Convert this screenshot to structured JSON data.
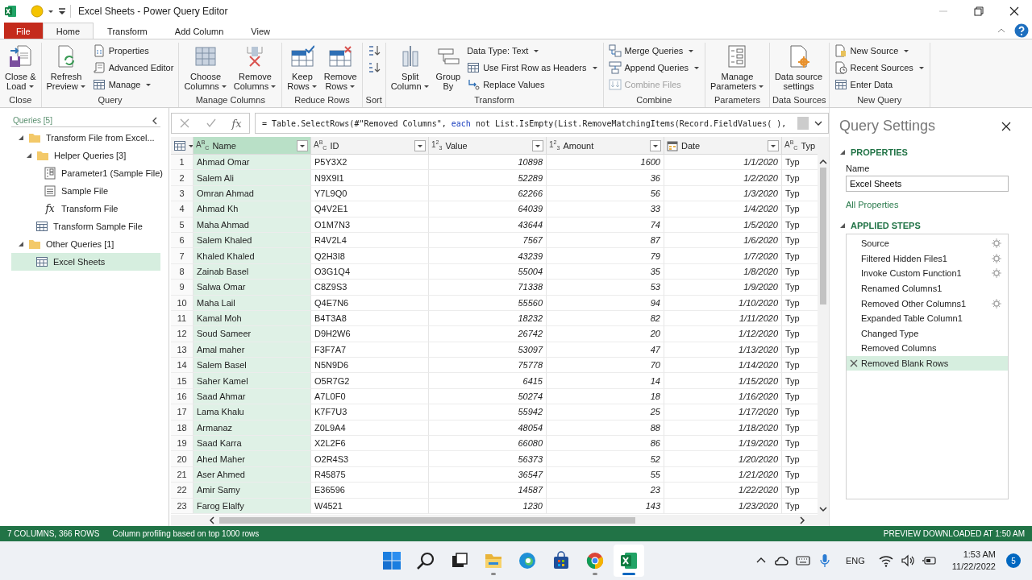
{
  "window": {
    "title": "Excel Sheets - Power Query Editor"
  },
  "ribbon_tabs": [
    {
      "label": "File",
      "kind": "file",
      "selected": false
    },
    {
      "label": "Home",
      "kind": "tab",
      "selected": true
    },
    {
      "label": "Transform",
      "kind": "tab",
      "selected": false
    },
    {
      "label": "Add Column",
      "kind": "tab",
      "selected": false
    },
    {
      "label": "View",
      "kind": "tab",
      "selected": false
    }
  ],
  "ribbon_groups": [
    {
      "label": "Close",
      "items": [
        {
          "kind": "big",
          "lines": [
            "Close &",
            "Load"
          ],
          "dropdown": true
        }
      ]
    },
    {
      "label": "Query",
      "items": [
        {
          "kind": "big",
          "lines": [
            "Refresh",
            "Preview"
          ],
          "dropdown": true
        },
        {
          "kind": "small",
          "label": "Properties",
          "dropdown": false
        },
        {
          "kind": "small",
          "label": "Advanced Editor",
          "dropdown": false
        },
        {
          "kind": "small",
          "label": "Manage",
          "dropdown": true
        }
      ]
    },
    {
      "label": "Manage Columns",
      "items": [
        {
          "kind": "big",
          "lines": [
            "Choose",
            "Columns"
          ],
          "dropdown": true
        },
        {
          "kind": "big",
          "lines": [
            "Remove",
            "Columns"
          ],
          "dropdown": true
        }
      ]
    },
    {
      "label": "Reduce Rows",
      "items": [
        {
          "kind": "big",
          "lines": [
            "Keep",
            "Rows"
          ],
          "dropdown": true
        },
        {
          "kind": "big",
          "lines": [
            "Remove",
            "Rows"
          ],
          "dropdown": true
        }
      ]
    },
    {
      "label": "Sort",
      "items": [
        {
          "kind": "small",
          "dropdown": false
        },
        {
          "kind": "small",
          "dropdown": false
        }
      ]
    },
    {
      "label": "Transform",
      "items": [
        {
          "kind": "big",
          "lines": [
            "Split",
            "Column"
          ],
          "dropdown": true
        },
        {
          "kind": "big",
          "lines": [
            "Group",
            "By"
          ],
          "dropdown": false
        },
        {
          "kind": "small",
          "label": "Data Type: Text",
          "dropdown": true
        },
        {
          "kind": "small",
          "label": "Use First Row as Headers",
          "dropdown": true
        },
        {
          "kind": "small",
          "label": "Replace Values",
          "dropdown": false
        }
      ]
    },
    {
      "label": "Combine",
      "items": [
        {
          "kind": "small",
          "label": "Merge Queries",
          "dropdown": true
        },
        {
          "kind": "small",
          "label": "Append Queries",
          "dropdown": true
        },
        {
          "kind": "small",
          "label": "Combine Files",
          "dropdown": false,
          "disabled": true
        }
      ]
    },
    {
      "label": "Parameters",
      "items": [
        {
          "kind": "big",
          "lines": [
            "Manage",
            "Parameters"
          ],
          "dropdown": true
        }
      ]
    },
    {
      "label": "Data Sources",
      "items": [
        {
          "kind": "big",
          "lines": [
            "Data source",
            "settings"
          ],
          "dropdown": false
        }
      ]
    },
    {
      "label": "New Query",
      "items": [
        {
          "kind": "small",
          "label": "New Source",
          "dropdown": true
        },
        {
          "kind": "small",
          "label": "Recent Sources",
          "dropdown": true
        },
        {
          "kind": "small",
          "label": "Enter Data",
          "dropdown": false
        }
      ]
    }
  ],
  "queries": {
    "title": "Queries [5]",
    "items": [
      {
        "label": "Transform File from Excel...",
        "kind": "folder",
        "expanded": true,
        "selected": false,
        "children": [
          {
            "label": "Helper Queries [3]",
            "kind": "folder",
            "expanded": true,
            "selected": false,
            "children": [
              {
                "label": "Parameter1 (Sample File)",
                "kind": "parameter",
                "selected": false
              },
              {
                "label": "Sample File",
                "kind": "file",
                "selected": false
              },
              {
                "label": "Transform File",
                "kind": "function",
                "glyph": "fx",
                "selected": false
              }
            ]
          },
          {
            "label": "Transform Sample File",
            "kind": "table",
            "selected": false
          }
        ]
      },
      {
        "label": "Other Queries [1]",
        "kind": "folder",
        "expanded": true,
        "selected": false,
        "children": [
          {
            "label": "Excel Sheets",
            "kind": "table",
            "selected": true
          }
        ]
      }
    ]
  },
  "formula_bar": {
    "fx": "fx",
    "formula": [
      {
        "text": "= Table.SelectRows(#\"Removed Columns\", ",
        "keyword": false
      },
      {
        "text": "each",
        "keyword": true
      },
      {
        "text": " not List.IsEmpty(List.RemoveMatchingItems(Record.FieldValues(_),",
        "keyword": false
      }
    ]
  },
  "table": {
    "columns": [
      {
        "name": "Name",
        "badge": "A$^{B}$$_{C}$",
        "kind": "text",
        "filter": true,
        "selected": true
      },
      {
        "name": "ID",
        "badge": "A$^{B}$$_{C}$",
        "kind": "text",
        "filter": true,
        "selected": false
      },
      {
        "name": "Value",
        "badge": "1$^{2}$$_{3}$",
        "kind": "number",
        "filter": true,
        "selected": false
      },
      {
        "name": "Amount",
        "badge": "1$^{2}$$_{3}$",
        "kind": "number",
        "filter": true,
        "selected": false
      },
      {
        "name": "Date",
        "kind": "date",
        "filter": true,
        "selected": false
      },
      {
        "name": "Typ",
        "badge": "A$^{B}$$_{C}$",
        "kind": "text",
        "filter": false,
        "selected": false
      }
    ],
    "rows": [
      {
        "number": "1",
        "cells": [
          "Ahmad Omar",
          "P5Y3X2",
          "10898",
          "1600",
          "1/1/2020",
          "Typ"
        ]
      },
      {
        "number": "2",
        "cells": [
          "Salem Ali",
          "N9X9I1",
          "52289",
          "36",
          "1/2/2020",
          "Typ"
        ]
      },
      {
        "number": "3",
        "cells": [
          "Omran Ahmad",
          "Y7L9Q0",
          "62266",
          "56",
          "1/3/2020",
          "Typ"
        ]
      },
      {
        "number": "4",
        "cells": [
          "Ahmad Kh",
          "Q4V2E1",
          "64039",
          "33",
          "1/4/2020",
          "Typ"
        ]
      },
      {
        "number": "5",
        "cells": [
          "Maha Ahmad",
          "O1M7N3",
          "43644",
          "74",
          "1/5/2020",
          "Typ"
        ]
      },
      {
        "number": "6",
        "cells": [
          "Salem Khaled",
          "R4V2L4",
          "7567",
          "87",
          "1/6/2020",
          "Typ"
        ]
      },
      {
        "number": "7",
        "cells": [
          "Khaled Khaled",
          "Q2H3I8",
          "43239",
          "79",
          "1/7/2020",
          "Typ"
        ]
      },
      {
        "number": "8",
        "cells": [
          "Zainab Basel",
          "O3G1Q4",
          "55004",
          "35",
          "1/8/2020",
          "Typ"
        ]
      },
      {
        "number": "9",
        "cells": [
          "Salwa Omar",
          "C8Z9S3",
          "71338",
          "53",
          "1/9/2020",
          "Typ"
        ]
      },
      {
        "number": "10",
        "cells": [
          "Maha Lail",
          "Q4E7N6",
          "55560",
          "94",
          "1/10/2020",
          "Typ"
        ]
      },
      {
        "number": "11",
        "cells": [
          "Kamal Moh",
          "B4T3A8",
          "18232",
          "82",
          "1/11/2020",
          "Typ"
        ]
      },
      {
        "number": "12",
        "cells": [
          "Soud Sameer",
          "D9H2W6",
          "26742",
          "20",
          "1/12/2020",
          "Typ"
        ]
      },
      {
        "number": "13",
        "cells": [
          "Amal maher",
          "F3F7A7",
          "53097",
          "47",
          "1/13/2020",
          "Typ"
        ]
      },
      {
        "number": "14",
        "cells": [
          "Salem Basel",
          "N5N9D6",
          "75778",
          "70",
          "1/14/2020",
          "Typ"
        ]
      },
      {
        "number": "15",
        "cells": [
          "Saher Kamel",
          "O5R7G2",
          "6415",
          "14",
          "1/15/2020",
          "Typ"
        ]
      },
      {
        "number": "16",
        "cells": [
          "Saad Ahmar",
          "A7L0F0",
          "50274",
          "18",
          "1/16/2020",
          "Typ"
        ]
      },
      {
        "number": "17",
        "cells": [
          "Lama Khalu",
          "K7F7U3",
          "55942",
          "25",
          "1/17/2020",
          "Typ"
        ]
      },
      {
        "number": "18",
        "cells": [
          "Armanaz",
          "Z0L9A4",
          "48054",
          "88",
          "1/18/2020",
          "Typ"
        ]
      },
      {
        "number": "19",
        "cells": [
          "Saad Karra",
          "X2L2F6",
          "66080",
          "86",
          "1/19/2020",
          "Typ"
        ]
      },
      {
        "number": "20",
        "cells": [
          "Ahed Maher",
          "O2R4S3",
          "56373",
          "52",
          "1/20/2020",
          "Typ"
        ]
      },
      {
        "number": "21",
        "cells": [
          "Aser Ahmed",
          "R45875",
          "36547",
          "55",
          "1/21/2020",
          "Typ"
        ]
      },
      {
        "number": "22",
        "cells": [
          "Amir Samy",
          "E36596",
          "14587",
          "23",
          "1/22/2020",
          "Typ"
        ]
      },
      {
        "number": "23",
        "cells": [
          "Farog Elalfy",
          "W4521",
          "1230",
          "143",
          "1/23/2020",
          "Typ"
        ]
      }
    ]
  },
  "query_settings": {
    "title": "Query Settings",
    "properties": {
      "heading": "PROPERTIES",
      "expanded": true,
      "name_label": "Name",
      "name_value": "Excel Sheets",
      "link": "All Properties"
    },
    "applied_steps": {
      "heading": "APPLIED STEPS",
      "expanded": true,
      "steps": [
        {
          "label": "Source",
          "settings": true,
          "selected": false
        },
        {
          "label": "Filtered Hidden Files1",
          "settings": true,
          "selected": false
        },
        {
          "label": "Invoke Custom Function1",
          "settings": true,
          "selected": false
        },
        {
          "label": "Renamed Columns1",
          "settings": false,
          "selected": false
        },
        {
          "label": "Removed Other Columns1",
          "settings": true,
          "selected": false
        },
        {
          "label": "Expanded Table Column1",
          "settings": false,
          "selected": false
        },
        {
          "label": "Changed Type",
          "settings": false,
          "selected": false
        },
        {
          "label": "Removed Columns",
          "settings": false,
          "selected": false
        },
        {
          "label": "Removed Blank Rows",
          "settings": false,
          "selected": true
        }
      ]
    }
  },
  "status_bar": {
    "columns_rows": "7 COLUMNS, 366 ROWS",
    "profiling": "Column profiling based on top 1000 rows",
    "preview": "PREVIEW DOWNLOADED AT 1:50 AM"
  },
  "taskbar": {
    "apps": [
      {
        "running": false,
        "selected": false
      },
      {
        "running": false,
        "selected": false
      },
      {
        "running": false,
        "selected": false
      },
      {
        "running": true,
        "selected": false
      },
      {
        "running": false,
        "selected": false
      },
      {
        "running": false,
        "selected": false
      },
      {
        "running": true,
        "selected": false
      },
      {
        "running": true,
        "selected": true
      }
    ],
    "language": "ENG",
    "time": "1:53 AM",
    "date": "11/22/2022",
    "notifications": "5"
  }
}
